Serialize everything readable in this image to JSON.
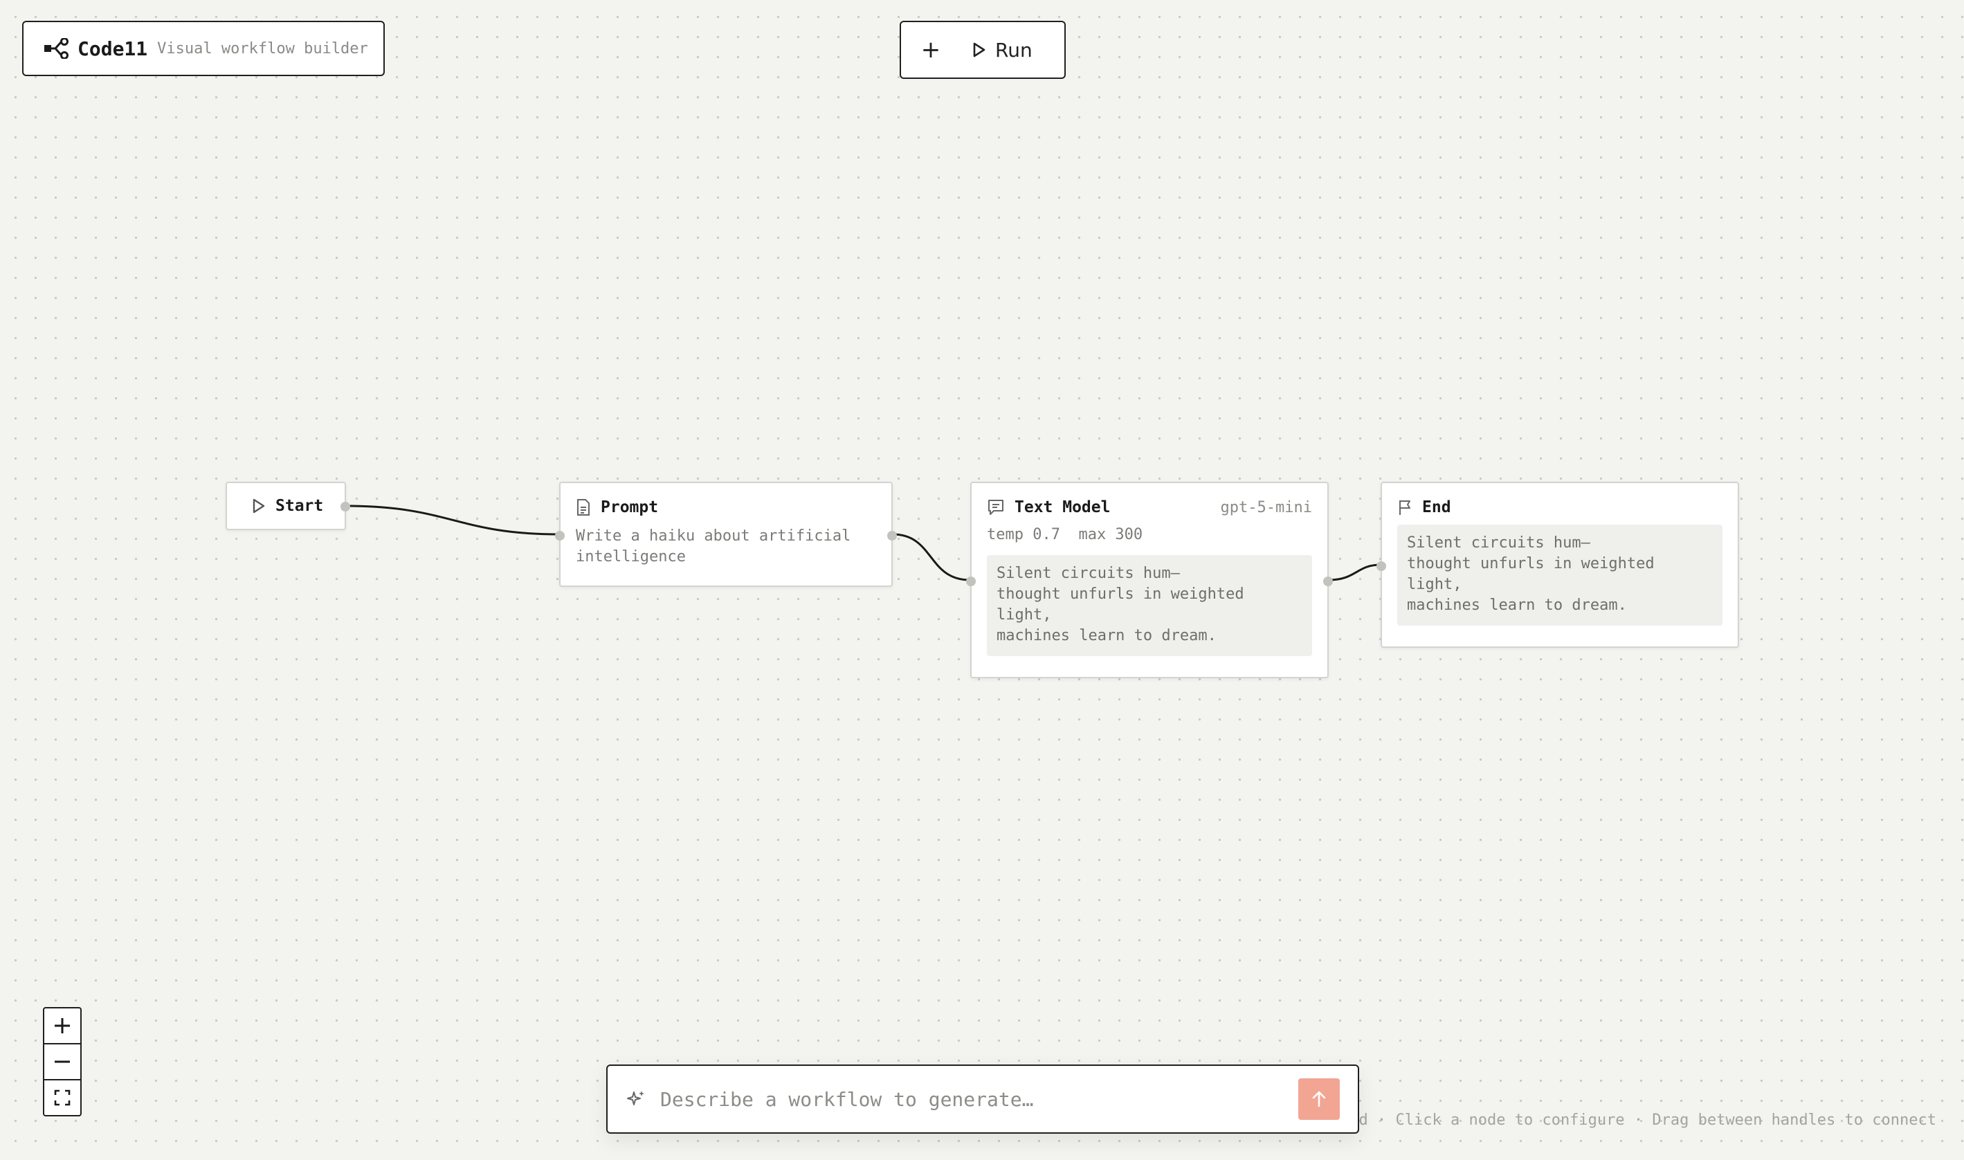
{
  "header": {
    "app_name": "Code11",
    "subtitle": "Visual workflow builder",
    "add_label": "+",
    "run_label": "Run"
  },
  "nodes": {
    "start": {
      "title": "Start"
    },
    "prompt": {
      "title": "Prompt",
      "text": "Write a haiku about artificial intelligence"
    },
    "text_model": {
      "title": "Text Model",
      "model": "gpt-5-mini",
      "params": "temp 0.7  max 300",
      "output": "Silent circuits hum—\nthought unfurls in weighted light,\nmachines learn to dream."
    },
    "end": {
      "title": "End",
      "output": "Silent circuits hum—\nthought unfurls in weighted light,\nmachines learn to dream."
    }
  },
  "generator": {
    "placeholder": "Describe a workflow to generate…"
  },
  "hints": "d · Click a node to configure · Drag between handles to connect",
  "colors": {
    "send_button": "#f2a593",
    "canvas": "#f3f3ef",
    "edge": "#1a1a1a"
  }
}
